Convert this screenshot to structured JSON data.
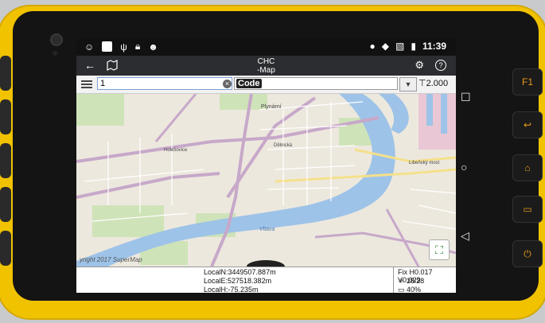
{
  "status_bar": {
    "time": "11:39",
    "left_icons": [
      "notification-icon",
      "square-icon",
      "usb-icon",
      "lock-icon",
      "android-icon"
    ],
    "right_icons": [
      "location-icon",
      "wifi-icon",
      "no-sim-icon",
      "battery-icon"
    ]
  },
  "app_bar": {
    "title": "CHC\n-Map",
    "back_icon": "back-arrow-icon",
    "map_icon": "map-icon",
    "settings_icon": "gear-icon",
    "help_icon": "help-icon"
  },
  "toolbar": {
    "point_name": "1",
    "code_value": "Code",
    "antenna_height": "2.000"
  },
  "map": {
    "watermark": "yright 2017 SuperMap",
    "labels": [
      "Plynární",
      "Dělnická",
      "Libeňský most",
      "Vltava",
      "Holešovice"
    ]
  },
  "coords": {
    "local_n": "LocalN:3449507.887m",
    "local_e": "LocalE:527518.382m",
    "local_h": "LocalH:-75.235m",
    "fix_status": "Fix H0.017 V0.029",
    "satellites": "18/28",
    "battery": "40%"
  },
  "hardware_buttons": {
    "f1_label": "F1"
  }
}
